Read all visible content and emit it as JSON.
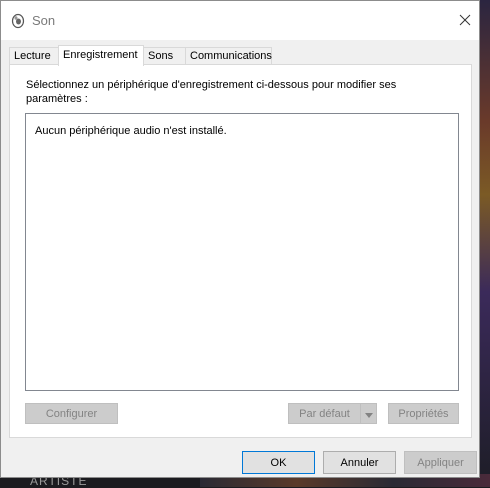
{
  "window": {
    "title": "Son",
    "icon": "speaker-icon",
    "close_icon": "close-icon"
  },
  "tabs": [
    {
      "label": "Lecture",
      "active": false
    },
    {
      "label": "Enregistrement",
      "active": true
    },
    {
      "label": "Sons",
      "active": false
    },
    {
      "label": "Communications",
      "active": false
    }
  ],
  "panel": {
    "instruction": "Sélectionnez un périphérique d'enregistrement ci-dessous pour modifier ses paramètres :",
    "empty_message": "Aucun périphérique audio n'est installé.",
    "configure_label": "Configurer",
    "default_label": "Par défaut",
    "properties_label": "Propriétés"
  },
  "footer": {
    "ok_label": "OK",
    "cancel_label": "Annuler",
    "apply_label": "Appliquer"
  },
  "background": {
    "bottom_text": "ARTISTE"
  },
  "colors": {
    "dialog_bg": "#f0f0f0",
    "focus_border": "#0078d7",
    "disabled_text": "#838383"
  }
}
